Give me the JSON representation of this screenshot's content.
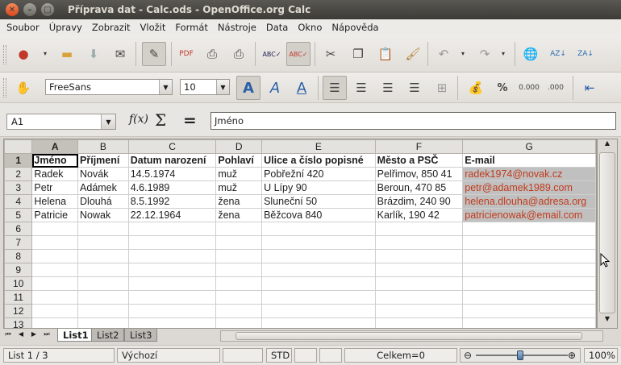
{
  "window": {
    "title": "Příprava dat - Calc.ods - OpenOffice.org Calc"
  },
  "menu": [
    "Soubor",
    "Úpravy",
    "Zobrazit",
    "Vložit",
    "Formát",
    "Nástroje",
    "Data",
    "Okno",
    "Nápověda"
  ],
  "toolbar2": {
    "font_name": "FreeSans",
    "font_size": "10"
  },
  "formula_bar": {
    "cell_ref": "A1",
    "content": "Jméno",
    "fx": "f(x)",
    "sigma": "Σ",
    "equals": "="
  },
  "sheet": {
    "columns": [
      "A",
      "B",
      "C",
      "D",
      "E",
      "F",
      "G"
    ],
    "rows": [
      {
        "n": "1",
        "cells": [
          "Jméno",
          "Příjmení",
          "Datum narození",
          "Pohlaví",
          "Ulice a číslo popisné",
          "Město a PSČ",
          "E-mail"
        ]
      },
      {
        "n": "2",
        "cells": [
          "Radek",
          "Novák",
          "14.5.1974",
          "muž",
          "Pobřežní 420",
          "Pelřimov, 850 41",
          "radek1974@novak.cz"
        ]
      },
      {
        "n": "3",
        "cells": [
          "Petr",
          "Adámek",
          "4.6.1989",
          "muž",
          "U Lípy 90",
          "Beroun, 470 85",
          "petr@adamek1989.com"
        ]
      },
      {
        "n": "4",
        "cells": [
          "Helena",
          "Dlouhá",
          "8.5.1992",
          "žena",
          "Sluneční 50",
          "Brázdim, 240 90",
          "helena.dlouha@adresa.org"
        ]
      },
      {
        "n": "5",
        "cells": [
          "Patricie",
          "Nowak",
          "22.12.1964",
          "žena",
          "Běžcova 840",
          "Karlík, 190 42",
          "patricienowak@email.com"
        ]
      },
      {
        "n": "6",
        "cells": [
          "",
          "",
          "",
          "",
          "",
          "",
          ""
        ]
      },
      {
        "n": "7",
        "cells": [
          "",
          "",
          "",
          "",
          "",
          "",
          ""
        ]
      },
      {
        "n": "8",
        "cells": [
          "",
          "",
          "",
          "",
          "",
          "",
          ""
        ]
      },
      {
        "n": "9",
        "cells": [
          "",
          "",
          "",
          "",
          "",
          "",
          ""
        ]
      },
      {
        "n": "10",
        "cells": [
          "",
          "",
          "",
          "",
          "",
          "",
          ""
        ]
      },
      {
        "n": "11",
        "cells": [
          "",
          "",
          "",
          "",
          "",
          "",
          ""
        ]
      },
      {
        "n": "12",
        "cells": [
          "",
          "",
          "",
          "",
          "",
          "",
          ""
        ]
      },
      {
        "n": "13",
        "cells": [
          "",
          "",
          "",
          "",
          "",
          "",
          ""
        ]
      }
    ]
  },
  "tabs": [
    "List1",
    "List2",
    "List3"
  ],
  "status": {
    "sheet": "List 1 / 3",
    "style": "Výchozí",
    "mode": "STD",
    "sum": "Celkem=0",
    "zoom": "100%"
  },
  "colors": {
    "email_text": "#c23a1c",
    "email_bg": "#c0c0c0"
  }
}
